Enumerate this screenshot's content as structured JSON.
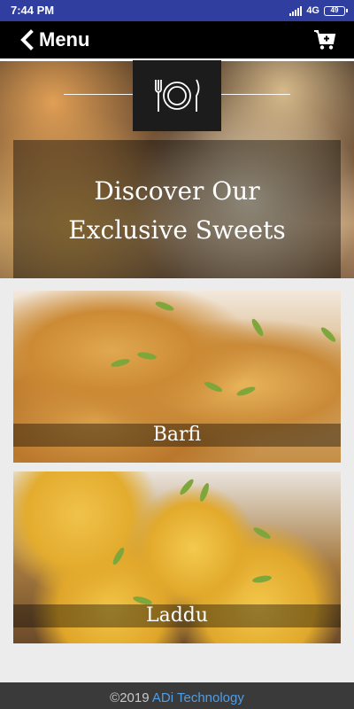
{
  "status_bar": {
    "time": "7:44 PM",
    "network": "4G",
    "battery": "49"
  },
  "app_bar": {
    "title": "Menu",
    "back_icon": "chevron-left-icon",
    "cart_icon": "cart-add-icon"
  },
  "hero": {
    "icon": "plate-cutlery-icon",
    "title_line1": "Discover Our",
    "title_line2": "Exclusive Sweets"
  },
  "items": [
    {
      "name": "Barfi"
    },
    {
      "name": "Laddu"
    }
  ],
  "footer": {
    "copyright": "©2019",
    "company": "ADi Technology"
  },
  "colors": {
    "status_bar": "#303f9f",
    "app_bar": "#000000",
    "footer": "#3a3a3a",
    "footer_link": "#4f9de6"
  }
}
